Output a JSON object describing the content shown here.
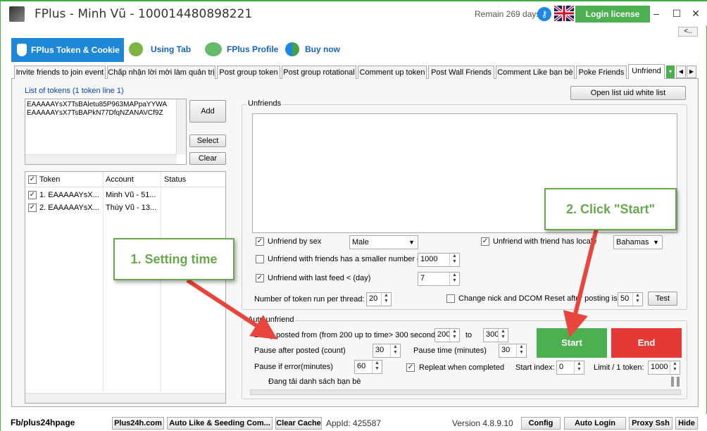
{
  "window": {
    "title": "FPlus - Minh Vũ - 100014480898221",
    "remain": "Remain 269 days",
    "login_label": "Login license",
    "min": "–",
    "max": "☐",
    "close": "✕"
  },
  "collapse_label": "<..",
  "main_tabs": [
    {
      "label": "FPlus Token & Cookie"
    },
    {
      "label": "Using Tab"
    },
    {
      "label": "FPlus Profile"
    },
    {
      "label": "Buy now"
    }
  ],
  "sub_tabs": [
    "Invite friends to join event",
    "Chấp nhận lời mời làm quản trị",
    "Post group token",
    "Post group rotational",
    "Comment up token",
    "Post Wall Friends",
    "Comment Like bạn bè",
    "Poke Friends",
    "Unfriend"
  ],
  "left": {
    "tokens_title": "List of tokens (1 token line 1)",
    "tokens_text": [
      "EAAAAAYsX7TsBAletu85P963MAPpaYYWA",
      "EAAAAAYsX7TsBAPkN77DfqNZANAVCf9Z"
    ],
    "add": "Add",
    "select": "Select",
    "clear": "Clear",
    "columns": [
      "Token",
      "Account",
      "Status"
    ],
    "rows": [
      {
        "token": "1. EAAAAAYsX...",
        "account": "Minh Vũ - 51...",
        "status": ""
      },
      {
        "token": "2. EAAAAAYsX...",
        "account": "Thúy Vũ - 13...",
        "status": ""
      }
    ]
  },
  "right": {
    "open_white_list": "Open list uid white list",
    "unfriends_title": "Unfriends",
    "by_sex": "Unfriend by sex",
    "sex": "Male",
    "by_locale": "Unfriend with friend has locale",
    "locale": "Bahamas",
    "smaller_friends": "Unfriend with friends has a smaller number of",
    "smaller_value": "1000",
    "last_feed": "Unfriend with last feed < (day)",
    "last_feed_value": "7",
    "tokens_per_thread": "Number of token run per thread:",
    "tokens_per_thread_value": "20",
    "change_nick": "Change nick and DCOM Reset after posting is",
    "change_nick_value": "50",
    "test": "Test",
    "auto_title": "Auto unfriend",
    "delay_label": "Delay posted from (from 200 up to time> 300 seconds)",
    "delay_from": "200",
    "to_label": "to",
    "delay_to": "300",
    "pause_after": "Pause after posted (count)",
    "pause_after_value": "30",
    "pause_time": "Pause time (minutes)",
    "pause_time_value": "30",
    "pause_error": "Pause if error(minutes)",
    "pause_error_value": "60",
    "repeat": "Repleat when completed",
    "start_index": "Start index:",
    "start_index_value": "0",
    "limit": "Limit / 1 token:",
    "limit_value": "1000",
    "start": "Start",
    "end": "End",
    "loading": "Đang tải danh sách bạn bè"
  },
  "status": {
    "fb": "Fb/plus24hpage",
    "plus": "Plus24h.com",
    "auto_like": "Auto Like & Seeding Com...",
    "clear_cache": "Clear Cache",
    "appid": "AppId: 425587",
    "version": "Version 4.8.9.10",
    "config": "Config",
    "auto_login": "Auto Login",
    "proxy": "Proxy Ssh",
    "hide": "Hide"
  },
  "callouts": {
    "one": "1. Setting time",
    "two": "2. Click \"Start\""
  },
  "colors": {
    "green": "#4caf50",
    "red": "#e53935",
    "blue": "#1e88d6",
    "arrow": "#e8453c",
    "callout": "#6aa84f"
  }
}
